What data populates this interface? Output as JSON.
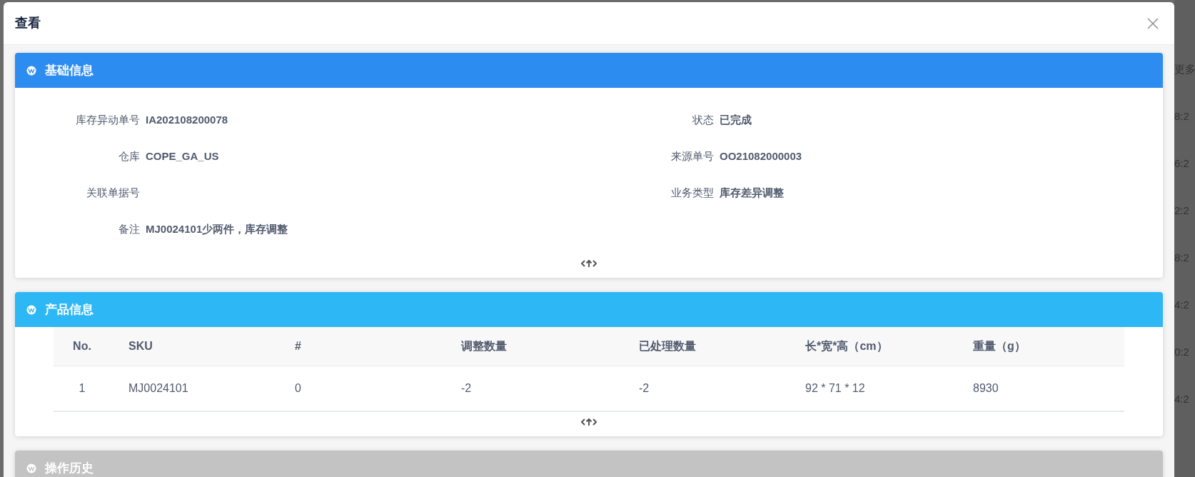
{
  "modal": {
    "title": "查看"
  },
  "sections": [
    {
      "kind": "fields",
      "title": "基础信息",
      "color": "#2d8cf0",
      "fields": [
        {
          "label": "库存异动单号",
          "value": "IA202108200078"
        },
        {
          "label": "状态",
          "value": "已完成"
        },
        {
          "label": "仓库",
          "value": "COPE_GA_US"
        },
        {
          "label": "来源单号",
          "value": "OO21082000003"
        },
        {
          "label": "关联单据号"
        },
        {
          "label": "业务类型",
          "value": "库存差异调整"
        },
        {
          "label": "备注",
          "value": "MJ0024101少两件，库存调整"
        }
      ]
    },
    {
      "kind": "table",
      "title": "产品信息",
      "color": "#2db7f5",
      "columns": [
        "No.",
        "SKU",
        "#",
        "调整数量",
        "已处理数量",
        "长*宽*高（cm）",
        "重量（g）"
      ],
      "rows": [
        [
          "1",
          "MJ0024101",
          "0",
          "-2",
          "-2",
          "92 * 71 * 12",
          "8930"
        ]
      ]
    },
    {
      "kind": "collapsed",
      "title": "操作历史",
      "color": "#c3c3c3"
    }
  ],
  "background_texts": [
    "更多",
    "8:2",
    "6:2",
    "2:2",
    "8:2",
    "4:2",
    "0:2",
    "4:2"
  ]
}
